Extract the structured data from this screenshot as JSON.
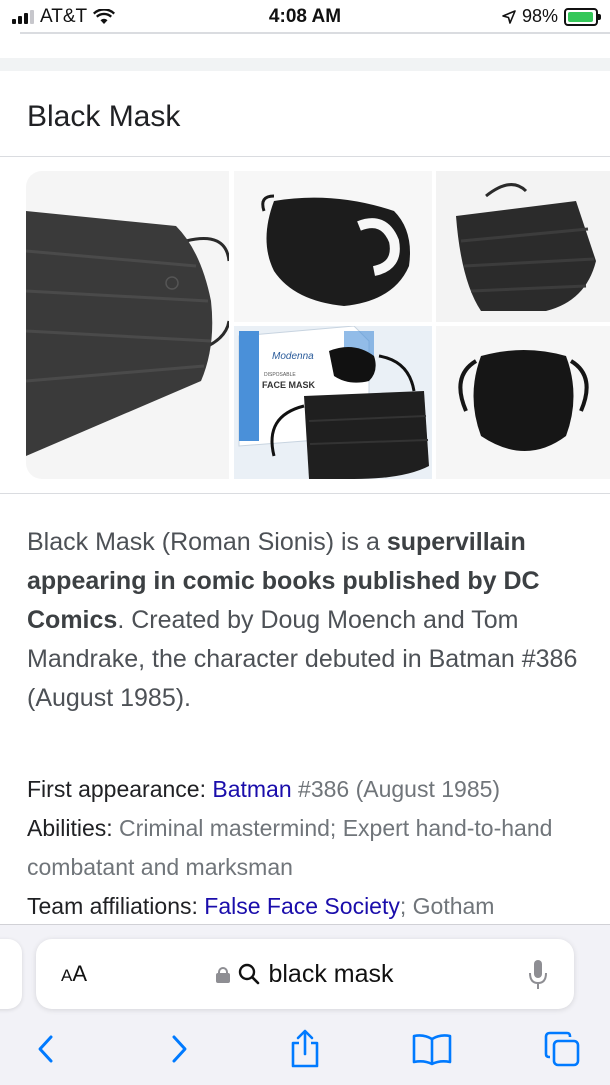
{
  "status_bar": {
    "carrier": "AT&T",
    "time": "4:08 AM",
    "battery_percent": "98%",
    "battery_level": 0.98,
    "battery_color": "#34c759"
  },
  "knowledge_panel": {
    "title": "Black Mask",
    "images": [
      {
        "name": "black-surgical-mask-closeup"
      },
      {
        "name": "black-fabric-mask"
      },
      {
        "name": "black-pleated-mask"
      },
      {
        "name": "disposable-face-mask-box"
      },
      {
        "name": "black-cloth-mask"
      }
    ],
    "image_text": {
      "brand": "Modenna",
      "product": "FACE MASK",
      "subtitle": "DISPOSABLE"
    },
    "description_plain_1": "Black Mask (Roman Sionis) is a ",
    "description_bold": "supervillain appearing in comic books published by DC Comics",
    "description_plain_2": ". Created by Doug Moench and Tom Mandrake, the character debuted in Batman #386 (August 1985).",
    "facts": [
      {
        "label": "First appearance: ",
        "link": "Batman",
        "value": " #386 (August 1985)"
      },
      {
        "label": "Abilities: ",
        "value": "Criminal mastermind; Expert hand-to-hand combatant and marksman"
      },
      {
        "label": "Team affiliations: ",
        "link": "False Face Society",
        "value": "; Gotham"
      }
    ]
  },
  "browser": {
    "text_size_label_small": "A",
    "text_size_label_large": "A",
    "address_text": "black mask",
    "link_color": "#1a0dab",
    "accent_color": "#007aff",
    "toolbar": {
      "icons": [
        "back-icon",
        "forward-icon",
        "share-icon",
        "bookmarks-icon",
        "tabs-icon"
      ]
    }
  }
}
